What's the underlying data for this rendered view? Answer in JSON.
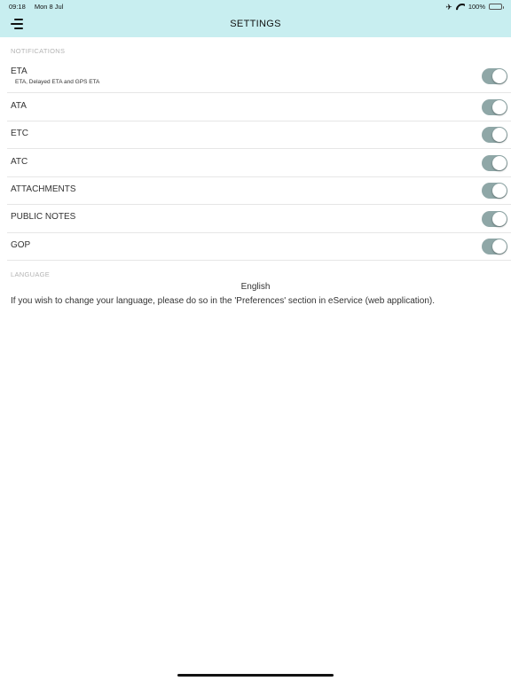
{
  "status_bar": {
    "time": "09:18",
    "date": "Mon 8 Jul",
    "battery": "100%",
    "icons": [
      "airplane-icon",
      "wifi-icon",
      "battery-icon"
    ]
  },
  "header": {
    "title": "SETTINGS",
    "menu_icon": "menu-icon",
    "background": "#c8eef0"
  },
  "notifications": {
    "section_title": "NOTIFICATIONS",
    "items": [
      {
        "label": "ETA",
        "sublabel": "ETA, Delayed ETA and GPS ETA",
        "enabled": true
      },
      {
        "label": "ATA",
        "enabled": true
      },
      {
        "label": "ETC",
        "enabled": true
      },
      {
        "label": "ATC",
        "enabled": true
      },
      {
        "label": "ATTACHMENTS",
        "enabled": true
      },
      {
        "label": "PUBLIC NOTES",
        "enabled": true
      },
      {
        "label": "GOP",
        "enabled": true
      }
    ],
    "toggle_on_color": "#8fa7a7"
  },
  "language": {
    "section_title": "LANGUAGE",
    "current": "English",
    "info": "If you wish to change your language, please do so in the 'Preferences' section in eService (web application)."
  }
}
